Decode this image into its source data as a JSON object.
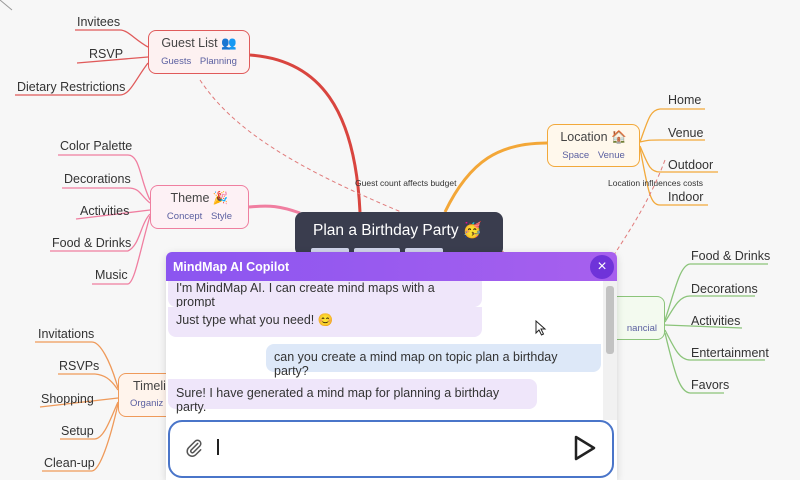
{
  "root": {
    "title": "Plan a Birthday Party",
    "emoji": "🥳"
  },
  "branches": {
    "guest_list": {
      "title": "Guest List",
      "emoji": "👥",
      "tags": [
        "Guests",
        "Planning"
      ],
      "color": "#e05a5a",
      "children": [
        "Invitees",
        "RSVP",
        "Dietary Restrictions"
      ]
    },
    "theme": {
      "title": "Theme",
      "emoji": "🎉",
      "tags": [
        "Concept",
        "Style"
      ],
      "color": "#ef7fa0",
      "children": [
        "Color Palette",
        "Decorations",
        "Activities",
        "Food & Drinks",
        "Music"
      ]
    },
    "location": {
      "title": "Location",
      "emoji": "🏠",
      "tags": [
        "Space",
        "Venue"
      ],
      "color": "#f2a93b",
      "children": [
        "Home",
        "Venue",
        "Outdoor",
        "Indoor"
      ]
    },
    "budget": {
      "tag_partial": "nancial",
      "color": "#8bc47a",
      "children": [
        "Food & Drinks",
        "Decorations",
        "Activities",
        "Entertainment",
        "Favors"
      ]
    },
    "timeline": {
      "title_partial": "Timeli",
      "tag_partial": "Organiz",
      "color": "#ef9a5a",
      "children": [
        "Invitations",
        "RSVPs",
        "Shopping",
        "Setup",
        "Clean-up"
      ]
    }
  },
  "relations": {
    "guest_budget": "Guest count affects budget",
    "location_costs": "Location influences costs"
  },
  "copilot": {
    "title": "MindMap AI Copilot",
    "close_icon": "×",
    "messages": [
      {
        "role": "bot",
        "text": "I'm MindMap AI. I can create mind maps with a prompt"
      },
      {
        "role": "bot",
        "text": "Just type what you need! 😊"
      },
      {
        "role": "user",
        "text": "can you create a mind map on topic plan a birthday party?"
      },
      {
        "role": "bot",
        "text": "Sure! I have generated a mind map for planning a birthday party."
      }
    ],
    "input_value": "",
    "icons": {
      "attach": "paperclip-icon",
      "send": "send-icon"
    },
    "accent": "#8b55f0"
  }
}
